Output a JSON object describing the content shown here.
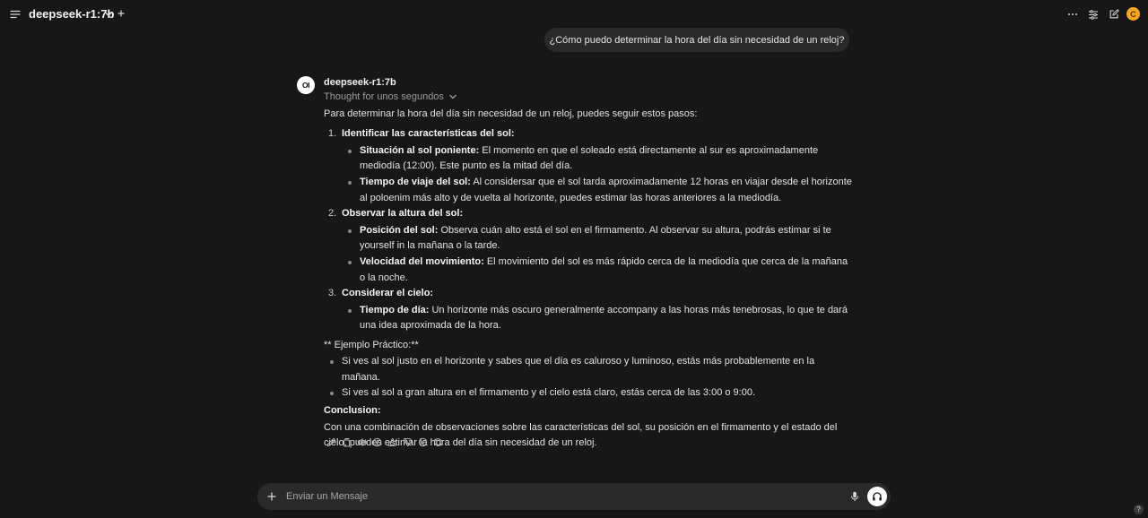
{
  "header": {
    "model_name": "deepseek-r1:7b",
    "user_initial": "C"
  },
  "user_message": "¿Cómo puedo determinar la hora del día sin necesidad de un reloj?",
  "assistant": {
    "avatar_text": "OI",
    "name": "deepseek-r1:7b",
    "thought_label": "Thought for unos segundos",
    "intro": "Para determinar la hora del día sin necesidad de un reloj, puedes seguir estos pasos:",
    "steps": [
      {
        "num": "1.",
        "title": "Identificar las características del sol:",
        "items": [
          {
            "key": "Situación al sol poniente:",
            "text": " El momento en que el soleado está directamente al sur es aproximadamente mediodía (12:00). Este punto es la mitad del día."
          },
          {
            "key": "Tiempo de viaje del sol:",
            "text": " Al considersar que el sol tarda aproximadamente 12 horas en viajar desde el horizonte al poloenim más alto y de vuelta al horizonte, puedes estimar las horas anteriores a la mediodía."
          }
        ]
      },
      {
        "num": "2.",
        "title": "Observar la altura del sol:",
        "items": [
          {
            "key": "Posición del sol:",
            "text": " Observa cuán alto está el sol en el firmamento. Al observar su altura, podrás estimar si te yourself in la mañana o la tarde."
          },
          {
            "key": "Velocidad del movimiento:",
            "text": " El movimiento del sol es más rápido cerca de la mediodía que cerca de la mañana o la noche."
          }
        ]
      },
      {
        "num": "3.",
        "title": "Considerar el cielo:",
        "items": [
          {
            "key": "Tiempo de día:",
            "text": " Un horizonte más oscuro generalmente accompany a las horas más tenebrosas, lo que te dará una idea aproximada de la hora."
          }
        ]
      }
    ],
    "example_heading": "** Ejemplo Práctico:**",
    "examples": [
      "Si ves al sol justo en el horizonte y sabes que el día es caluroso y luminoso, estás más probablemente en la mañana.",
      "Si ves al sol a gran altura en el firmamento y el cielo está claro, estás cerca de las 3:00 o 9:00."
    ],
    "conclusion_title": "Conclusion:",
    "conclusion_text": "Con una combinación de observaciones sobre las características del sol, su posición en el firmamento y el estado del cielo, puedes estimar la hora del día sin necesidad de un reloj."
  },
  "input": {
    "placeholder": "Enviar un Mensaje"
  },
  "help_label": "?"
}
